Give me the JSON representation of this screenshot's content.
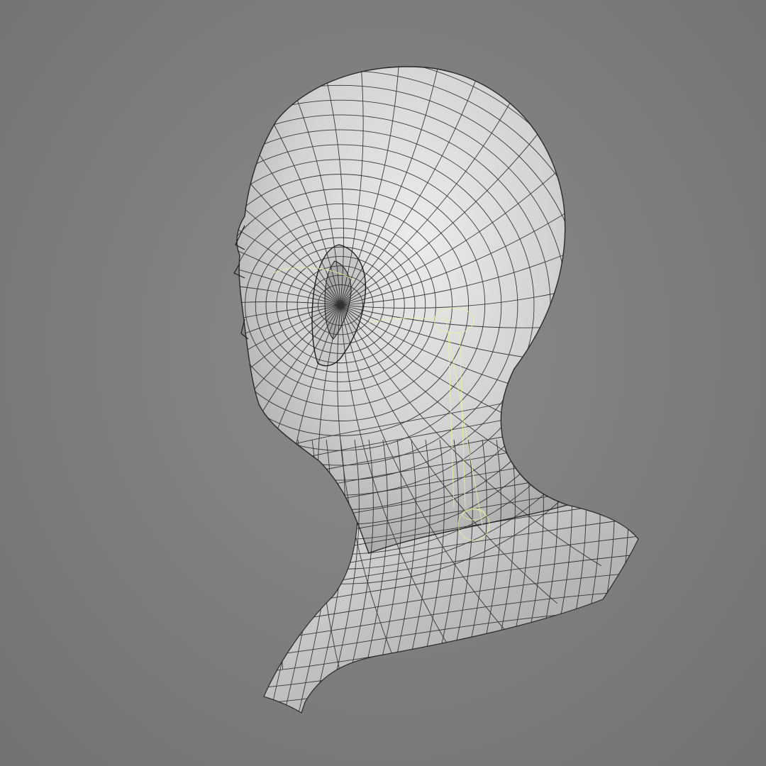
{
  "viewport": {
    "background_color": "#7c7c7c",
    "model": {
      "subject": "head-bust",
      "display_mode": "wireframe-on-shaded",
      "surface_color": "#d8d8d8",
      "edge_color": "#1e1e1e",
      "rig_overlay_color": "#e8f0a0"
    }
  }
}
